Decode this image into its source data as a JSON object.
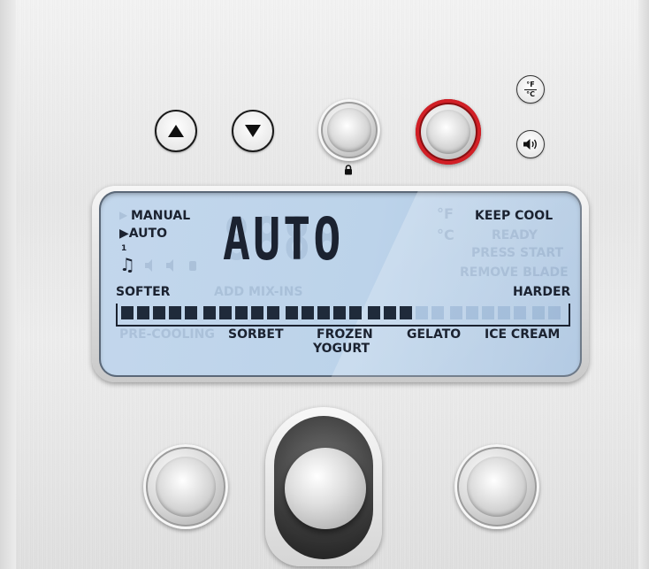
{
  "lcd": {
    "mode_manual": "MANUAL",
    "mode_auto": "▶AUTO",
    "super_one": "1",
    "music_glyph": "♫",
    "main_display": "AUTO",
    "keep_cool": "KEEP COOL",
    "ready": "READY",
    "press_start": "PRESS START",
    "remove_blade": "REMOVE BLADE",
    "add_mix_ins": "ADD MIX-INS",
    "softer": "SOFTER",
    "harder": "HARDER",
    "pre_cooling": "PRE-COOLING",
    "sorbet": "SORBET",
    "frozen": "FROZEN",
    "yogurt": "YOGURT",
    "gelato": "GELATO",
    "ice_cream": "ICE CREAM",
    "unit_f": "°F",
    "unit_c": "°C",
    "hardness_level": 0.68
  },
  "buttons": {
    "temp_unit_top": "°F",
    "temp_unit_bottom": "°C"
  },
  "icons": {
    "up": "up-arrow-icon",
    "down": "down-arrow-icon",
    "lock": "lock-icon",
    "temp_unit": "temperature-unit-icon",
    "sound": "speaker-icon",
    "music": "music-note-icon"
  },
  "colors": {
    "lcd_background": "#bcd3ea",
    "lcd_text": "#1b2230",
    "power_ring": "#d21f26"
  }
}
